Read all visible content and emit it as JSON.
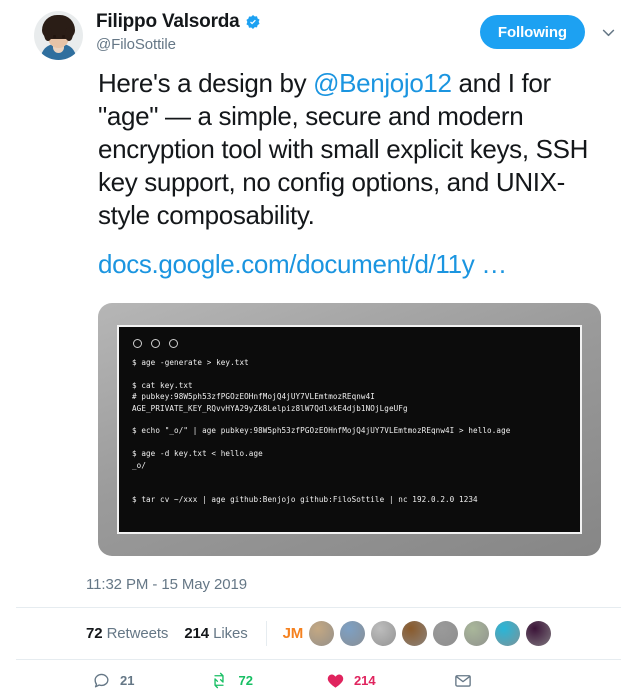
{
  "author": {
    "display_name": "Filippo Valsorda",
    "handle": "@FiloSottile",
    "verified_icon": "verified-badge-icon",
    "avatar_icon": "profile-avatar"
  },
  "follow": {
    "button_label": "Following",
    "caret_icon": "chevron-down-icon"
  },
  "tweet": {
    "text_before_mention": "Here's a design by ",
    "mention": "@Benjojo12",
    "text_after_mention": " and I for \"age\" — a simple, secure and modern encryption tool with small explicit keys, SSH key support, no config options, and UNIX-style composability.",
    "link": "docs.google.com/document/d/11y …"
  },
  "media": {
    "type": "terminal-screenshot",
    "window_dots": [
      "close-dot",
      "minimize-dot",
      "zoom-dot"
    ],
    "lines": [
      "$ age -generate > key.txt",
      "",
      "$ cat key.txt",
      "# pubkey:98W5ph53zfPGOzEOHnfMojQ4jUY7VLEmtmozREqnw4I",
      "AGE_PRIVATE_KEY_RQvvHYA29yZk8Lelpiz8lW7QdlxkE4djb1NOjLgeUFg",
      "",
      "$ echo \"_o/\" | age pubkey:98W5ph53zfPGOzEOHnfMojQ4jUY7VLEmtmozREqnw4I > hello.age",
      "",
      "$ age -d key.txt < hello.age",
      "_o/",
      "",
      "",
      "$ tar cv ~/xxx | age github:Benjojo github:FiloSottile | nc 192.0.2.0 1234"
    ]
  },
  "timestamp": "11:32 PM - 15 May 2019",
  "stats": {
    "retweets_count": "72",
    "retweets_label": "Retweets",
    "likes_count": "214",
    "likes_label": "Likes",
    "liker_initials": "JM",
    "liker_avatars": [
      {
        "name": "liker-avatar-1",
        "color": "#c4a882"
      },
      {
        "name": "liker-avatar-2",
        "color": "#7da0c4"
      },
      {
        "name": "liker-avatar-3",
        "color": "#bdbdbd"
      },
      {
        "name": "liker-avatar-4",
        "color": "#8a5a2b"
      },
      {
        "name": "liker-avatar-5",
        "color": "#9a9a9a"
      },
      {
        "name": "liker-avatar-6",
        "color": "#a9b79a"
      },
      {
        "name": "liker-avatar-7",
        "color": "#29b6d8"
      },
      {
        "name": "liker-avatar-8",
        "color": "#3b1338"
      }
    ]
  },
  "actions": {
    "reply_icon": "reply-icon",
    "reply_count": "21",
    "retweet_icon": "retweet-icon",
    "retweet_count": "72",
    "like_icon": "heart-icon",
    "like_count": "214",
    "share_icon": "share-envelope-icon"
  },
  "colors": {
    "accent": "#1da1f2",
    "link": "#1b95e0",
    "retweet_green": "#17bf63",
    "like_red": "#e0245e",
    "muted": "#657786",
    "text": "#14171a"
  }
}
